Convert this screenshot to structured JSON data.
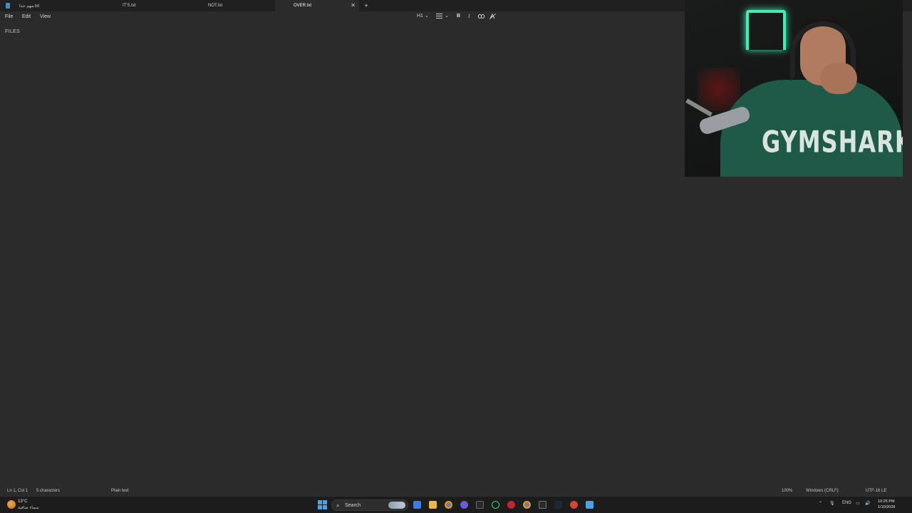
{
  "tabs": [
    {
      "label": "مهم جدا.txt"
    },
    {
      "label": "IT'S.txt"
    },
    {
      "label": "NOT.txt"
    },
    {
      "label": "OVER.txt"
    }
  ],
  "tab_close_glyph": "✕",
  "new_tab_glyph": "+",
  "menu": {
    "file": "File",
    "edit": "Edit",
    "view": "View"
  },
  "toolbar": {
    "heading": "H1",
    "heading_caret": "⌄",
    "list_caret": "⌄",
    "bold": "B",
    "italic": "I"
  },
  "sidebar": {
    "files_label": "FILES"
  },
  "webcam": {
    "shirt_text": "GYMSHARK"
  },
  "status": {
    "position": "Ln 1, Col 1",
    "characters": "5 characters",
    "format": "Plain text",
    "zoom": "100%",
    "line_ending": "Windows (CRLF)",
    "encoding": "UTF-16 LE"
  },
  "taskbar": {
    "weather_temp": "13°C",
    "weather_desc": "سماء صافية",
    "search_label": "Search",
    "language": "ENG",
    "time": "10:25 PM",
    "date": "1/10/2026"
  },
  "colors": {
    "editor_bg": "#2b2b2b",
    "tabbar_bg": "#202020",
    "taskbar_bg": "#1c1c1c",
    "accent": "#4aa3e6",
    "neon": "#3bf0b8"
  }
}
